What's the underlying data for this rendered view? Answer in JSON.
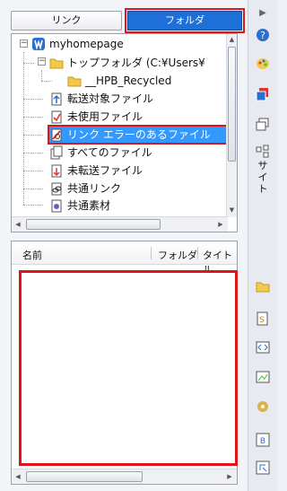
{
  "tabs": {
    "link": "リンク",
    "folder": "フォルダ"
  },
  "tree": {
    "root": "myhomepage",
    "top_folder": "トップフォルダ (C:¥Users¥",
    "recycled": "__HPB_Recycled",
    "items": [
      "転送対象ファイル",
      "未使用ファイル",
      "リンク エラーのあるファイル",
      "すべてのファイル",
      "未転送ファイル",
      "共通リンク",
      "共通素材"
    ]
  },
  "list": {
    "col_name": "名前",
    "col_folder": "フォルダ",
    "col_title": "タイトル"
  },
  "sidebar": {
    "site_label": "サイト"
  },
  "colors": {
    "accent": "#1e6fd8",
    "highlight": "#e0141b",
    "selection": "#3399ff"
  }
}
